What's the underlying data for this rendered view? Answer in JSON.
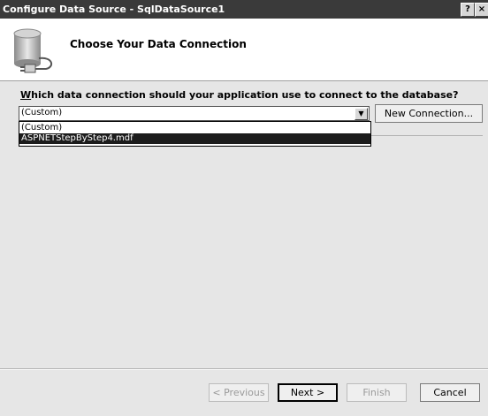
{
  "window": {
    "title": "Configure Data Source - SqlDataSource1",
    "help_label": "?",
    "close_label": "×"
  },
  "header": {
    "heading": "Choose Your Data Connection"
  },
  "main": {
    "question_accel": "W",
    "question_rest": "hich data connection should your application use to connect to the database?",
    "combo_value": "(Custom)",
    "combo_arrow": "▼",
    "new_connection_label": "New Connection...",
    "options": [
      "(Custom)",
      "ASPNETStepByStep4.mdf"
    ],
    "selected_option_index": 1
  },
  "footer": {
    "previous_label": "< Previous",
    "next_label": "Next >",
    "finish_label": "Finish",
    "cancel_label": "Cancel"
  }
}
